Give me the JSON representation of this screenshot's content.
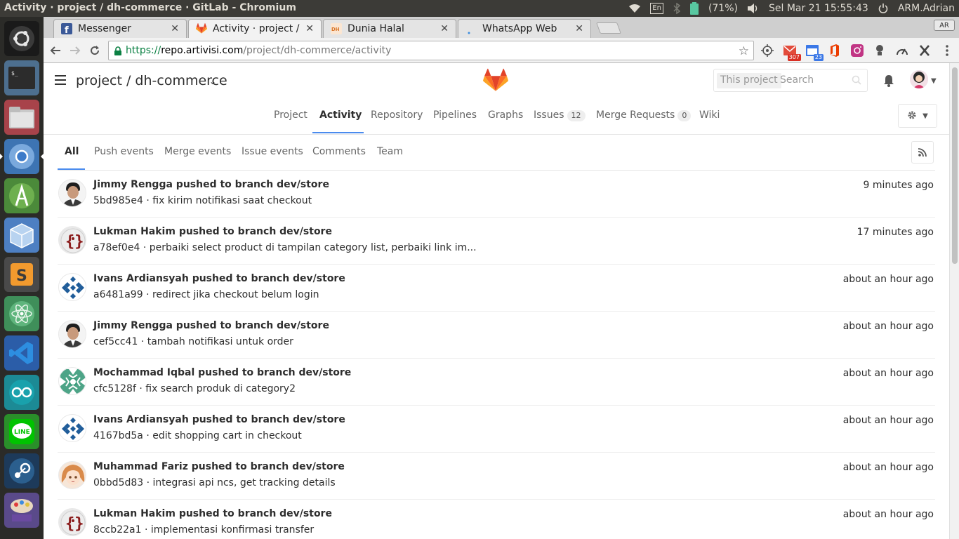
{
  "os": {
    "window_title": "Activity · project / dh-commerce · GitLab - Chromium",
    "lang": "En",
    "battery": "(71%)",
    "datetime": "Sel Mar 21 15:55:43",
    "user": "ARM.Adrian"
  },
  "browser": {
    "tabs": [
      {
        "label": "Messenger",
        "icon": "facebook-icon"
      },
      {
        "label": "Activity · project / dh",
        "icon": "gitlab-icon"
      },
      {
        "label": "Dunia Halal",
        "icon": "dunia-halal-icon"
      },
      {
        "label": "WhatsApp Web",
        "icon": "whatsapp-icon"
      }
    ],
    "profile": "AR",
    "url": {
      "scheme": "https://",
      "host": "repo.artivisi.com",
      "path": "/project/dh-commerce/activity"
    },
    "ext_badges": {
      "gmail": "307",
      "cal": "23"
    }
  },
  "header": {
    "project_path": "project / dh-commerce",
    "search_scope": "This project",
    "search_placeholder": "Search"
  },
  "project_nav": [
    {
      "label": "Project"
    },
    {
      "label": "Activity"
    },
    {
      "label": "Repository"
    },
    {
      "label": "Pipelines"
    },
    {
      "label": "Graphs"
    },
    {
      "label": "Issues",
      "count": "12"
    },
    {
      "label": "Merge Requests",
      "count": "0"
    },
    {
      "label": "Wiki"
    }
  ],
  "event_filter": [
    "All",
    "Push events",
    "Merge events",
    "Issue events",
    "Comments",
    "Team"
  ],
  "events": [
    {
      "author": "Jimmy Rengga",
      "action": "pushed to branch",
      "branch": "dev/store",
      "sha": "5bd985e4",
      "message": "fix kirim notifikasi saat checkout",
      "time": "9 minutes ago",
      "avatar": "photo-man"
    },
    {
      "author": "Lukman Hakim",
      "action": "pushed to branch",
      "branch": "dev/store",
      "sha": "a78ef0e4",
      "message": "perbaiki select product di tampilan category list, perbaiki link im...",
      "time": "17 minutes ago",
      "avatar": "code-brackets"
    },
    {
      "author": "Ivans Ardiansyah",
      "action": "pushed to branch",
      "branch": "dev/store",
      "sha": "a6481a99",
      "message": "redirect jika checkout belum login",
      "time": "about an hour ago",
      "avatar": "identicon-blue"
    },
    {
      "author": "Jimmy Rengga",
      "action": "pushed to branch",
      "branch": "dev/store",
      "sha": "cef5cc41",
      "message": "tambah notifikasi untuk order",
      "time": "about an hour ago",
      "avatar": "photo-man"
    },
    {
      "author": "Mochammad Iqbal",
      "action": "pushed to branch",
      "branch": "dev/store",
      "sha": "cfc5128f",
      "message": "fix search produk di category2",
      "time": "about an hour ago",
      "avatar": "identicon-green"
    },
    {
      "author": "Ivans Ardiansyah",
      "action": "pushed to branch",
      "branch": "dev/store",
      "sha": "4167bd5a",
      "message": "edit shopping cart in checkout",
      "time": "about an hour ago",
      "avatar": "identicon-blue"
    },
    {
      "author": "Muhammad Fariz",
      "action": "pushed to branch",
      "branch": "dev/store",
      "sha": "0bbd5d83",
      "message": "integrasi api ncs, get tracking details",
      "time": "about an hour ago",
      "avatar": "anime-girl"
    },
    {
      "author": "Lukman Hakim",
      "action": "pushed to branch",
      "branch": "dev/store",
      "sha": "8ccb22a1",
      "message": "implementasi konfirmasi transfer",
      "time": "about an hour ago",
      "avatar": "code-brackets"
    }
  ],
  "colors": {
    "accent": "#4a8bee",
    "gitlab_orange": "#fc6d26",
    "gitlab_red": "#e24329",
    "gitlab_yellow": "#fca326"
  }
}
